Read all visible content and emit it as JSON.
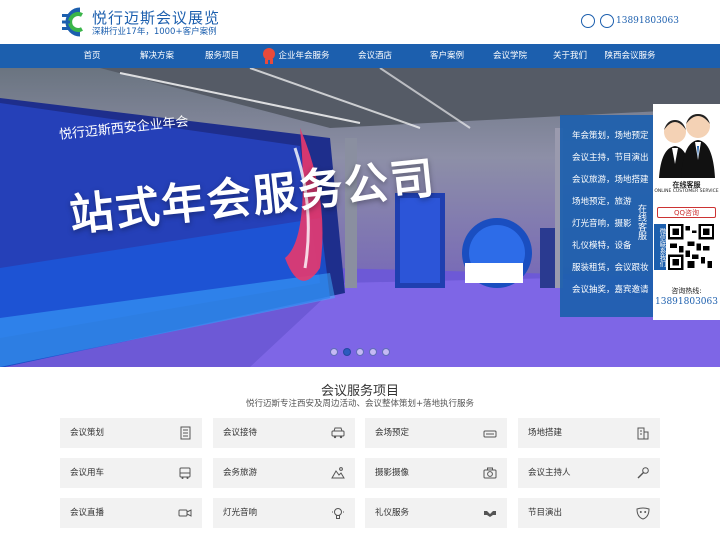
{
  "header": {
    "brand": "悦行迈斯会议展览",
    "slogan": "深耕行业17年，1000+客户案例",
    "phone": "13891803063"
  },
  "nav": {
    "items": [
      {
        "label": "首页"
      },
      {
        "label": "解决方案"
      },
      {
        "label": "服务项目"
      },
      {
        "label": "企业年会服务"
      },
      {
        "label": "会议酒店"
      },
      {
        "label": "客户案例"
      },
      {
        "label": "会议学院"
      },
      {
        "label": "关于我们"
      },
      {
        "label": "陕西会议服务"
      }
    ]
  },
  "banner": {
    "line1": "悦行迈斯西安企业年会",
    "line2": "站式年会服务公司",
    "slides": 5,
    "active_slide": 1
  },
  "services_panel": {
    "items": [
      "年会策划，场地预定",
      "会议主持，节目演出",
      "会议旅游，场地搭建",
      "场地预定，旅游",
      "灯光音响，摄影",
      "礼仪模特，设备",
      "服装租赁，会议跟妆",
      "会议抽奖，嘉宾邀请"
    ],
    "tab": "在线客服"
  },
  "customer_service": {
    "title": "在线客服",
    "subtitle": "ONLINE CUSTOMER SERVICE",
    "qq": "QQ咨询",
    "qr_side": "微信联系我们",
    "hotline_label": "咨询热线:",
    "hotline": "13891803063"
  },
  "section": {
    "title": "会议服务项目",
    "subtitle": "悦行迈斯专注西安及周边活动、会议整体策划+落地执行服务",
    "cards": [
      {
        "label": "会议策划",
        "icon": "document-icon"
      },
      {
        "label": "会议接待",
        "icon": "car-icon"
      },
      {
        "label": "会场预定",
        "icon": "sofa-icon"
      },
      {
        "label": "场地搭建",
        "icon": "building-icon"
      },
      {
        "label": "会议用车",
        "icon": "bus-icon"
      },
      {
        "label": "会务旅游",
        "icon": "mountain-icon"
      },
      {
        "label": "摄影摄像",
        "icon": "camera-icon"
      },
      {
        "label": "会议主持人",
        "icon": "microphone-icon"
      },
      {
        "label": "会议直播",
        "icon": "video-icon"
      },
      {
        "label": "灯光音响",
        "icon": "bulb-icon"
      },
      {
        "label": "礼仪服务",
        "icon": "handshake-icon"
      },
      {
        "label": "节目演出",
        "icon": "mask-icon"
      }
    ]
  },
  "colors": {
    "primary": "#1c5fae",
    "card_bg": "#f2f2f2"
  }
}
